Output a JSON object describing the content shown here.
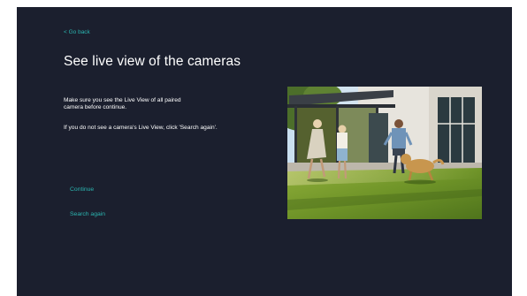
{
  "nav": {
    "back_label": "< Go back"
  },
  "page": {
    "title": "See live view of the cameras",
    "instructions": "Make sure you see the Live View of all paired camera before continue.",
    "hint": "If you do not see a camera's Live View, click 'Search again'."
  },
  "actions": {
    "continue_label": "Continue",
    "search_again_label": "Search again"
  },
  "colors": {
    "background": "#1b1f2e",
    "accent": "#2bb5b0",
    "text": "#ffffff"
  }
}
